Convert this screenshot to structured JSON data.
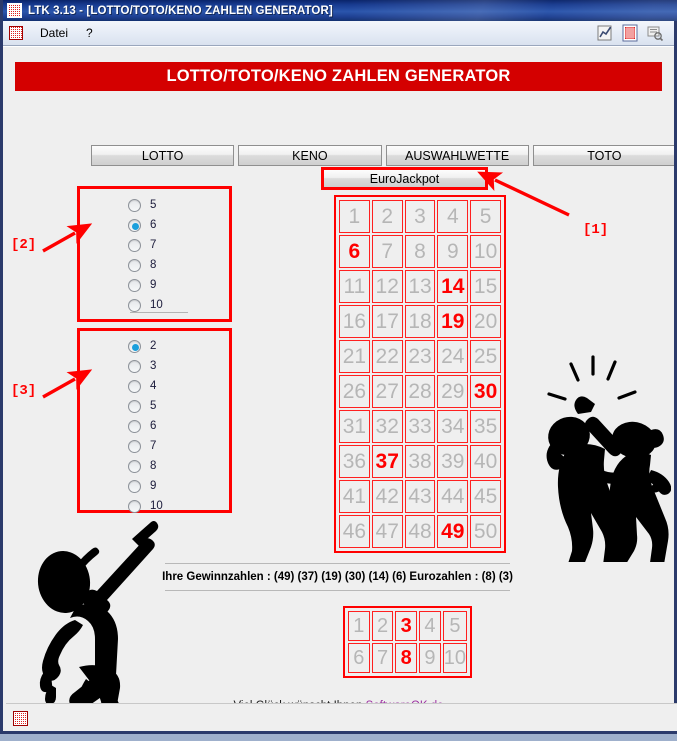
{
  "window": {
    "title": "LTK 3.13 - [LOTTO/TOTO/KENO ZAHLEN GENERATOR]",
    "app_icon": "grid-icon"
  },
  "menubar": {
    "icon": "grid-icon",
    "items": [
      {
        "label": "Datei"
      },
      {
        "label": "?"
      }
    ],
    "tools": [
      {
        "name": "chart-icon"
      },
      {
        "name": "generator-icon"
      },
      {
        "name": "inspect-icon"
      }
    ]
  },
  "banner": {
    "title": "LOTTO/TOTO/KENO ZAHLEN GENERATOR",
    "color": "#d40000"
  },
  "tabs": [
    {
      "label": "LOTTO",
      "selected": false
    },
    {
      "label": "KENO",
      "selected": false
    },
    {
      "label": "AUSWAHLWETTE",
      "selected": false
    },
    {
      "label": "TOTO",
      "selected": false
    }
  ],
  "eurojackpot_button": {
    "label": "EuroJackpot",
    "focused": true,
    "focus_color": "#23a0d8"
  },
  "groups": {
    "main_numbers_count": {
      "options": [
        "5",
        "6",
        "7",
        "8",
        "9",
        "10"
      ],
      "selected": "6"
    },
    "euro_numbers_count": {
      "options": [
        "2",
        "3",
        "4",
        "5",
        "6",
        "7",
        "8",
        "9",
        "10"
      ],
      "selected": "2"
    }
  },
  "number_grid": {
    "min": 1,
    "max": 50,
    "columns": 5,
    "drawn": [
      6,
      14,
      19,
      30,
      37,
      49
    ]
  },
  "euro_grid": {
    "min": 1,
    "max": 10,
    "columns": 5,
    "drawn": [
      3,
      8
    ]
  },
  "result": {
    "text": "Ihre Gewinnzahlen : (49) (37) (19) (30) (14) (6) Eurozahlen : (8) (3)",
    "main_numbers": [
      49,
      37,
      19,
      30,
      14,
      6
    ],
    "euro_numbers": [
      8,
      3
    ]
  },
  "footer": {
    "text": "Viel Glück wünscht Ihnen ",
    "link": "SoftwareOK.de",
    "link_color": "#9b2ea0"
  },
  "annotations": {
    "color": "#ff0000",
    "markers": [
      {
        "label": "[1]",
        "target": "eurojackpot-button"
      },
      {
        "label": "[2]",
        "target": "main-numbers-count-group"
      },
      {
        "label": "[3]",
        "target": "euro-numbers-count-group"
      }
    ]
  },
  "figures": [
    {
      "name": "pointing-person-silhouette"
    },
    {
      "name": "celebrating-couple-silhouette"
    }
  ],
  "statusbar": {
    "icon": "grid-icon"
  }
}
